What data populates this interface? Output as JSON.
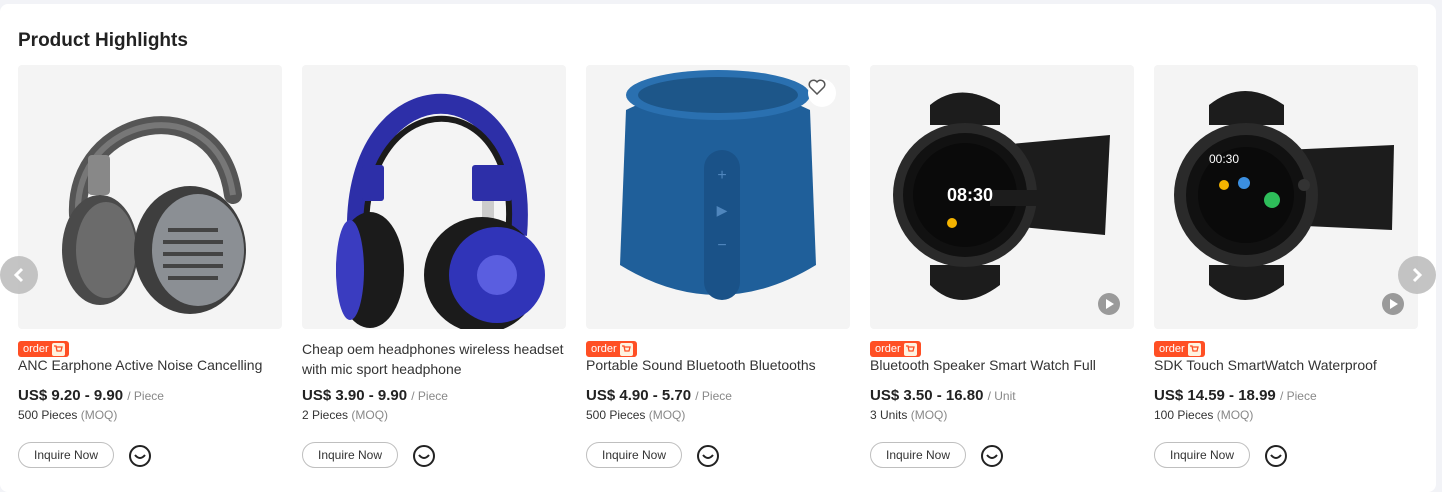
{
  "section": {
    "title": "Product Highlights"
  },
  "labels": {
    "inquire": "Inquire Now",
    "moq_tag": "(MOQ)"
  },
  "products": [
    {
      "badge": "order",
      "name": "ANC Earphone Active Noise Cancelling",
      "price": "US$ 9.20 - 9.90",
      "unit": "/ Piece",
      "moq": "500 Pieces"
    },
    {
      "badge": "",
      "name": "Cheap oem headphones wireless headset with mic sport headphone",
      "price": "US$ 3.90 - 9.90",
      "unit": "/ Piece",
      "moq": "2 Pieces"
    },
    {
      "badge": "order",
      "name": "Portable Sound Bluetooth Bluetooths",
      "price": "US$ 4.90 - 5.70",
      "unit": "/ Piece",
      "moq": "500 Pieces"
    },
    {
      "badge": "order",
      "name": "Bluetooth Speaker Smart Watch Full",
      "price": "US$ 3.50 - 16.80",
      "unit": "/ Unit",
      "moq": "3 Units"
    },
    {
      "badge": "order",
      "name": "SDK Touch SmartWatch Waterproof",
      "price": "US$ 14.59 - 18.99",
      "unit": "/ Piece",
      "moq": "100 Pieces"
    }
  ],
  "screen_text": {
    "watch1_time": "08:30",
    "watch2_time": "00:30"
  },
  "icons": {
    "prev": "chevron-left-icon",
    "next": "chevron-right-icon",
    "favorite": "heart-icon",
    "video": "play-icon",
    "chat": "chat-icon"
  },
  "colors": {
    "badge": "#ff4f24",
    "speaker": "#1f5f9a",
    "headphone2": "#2d2fa8"
  }
}
